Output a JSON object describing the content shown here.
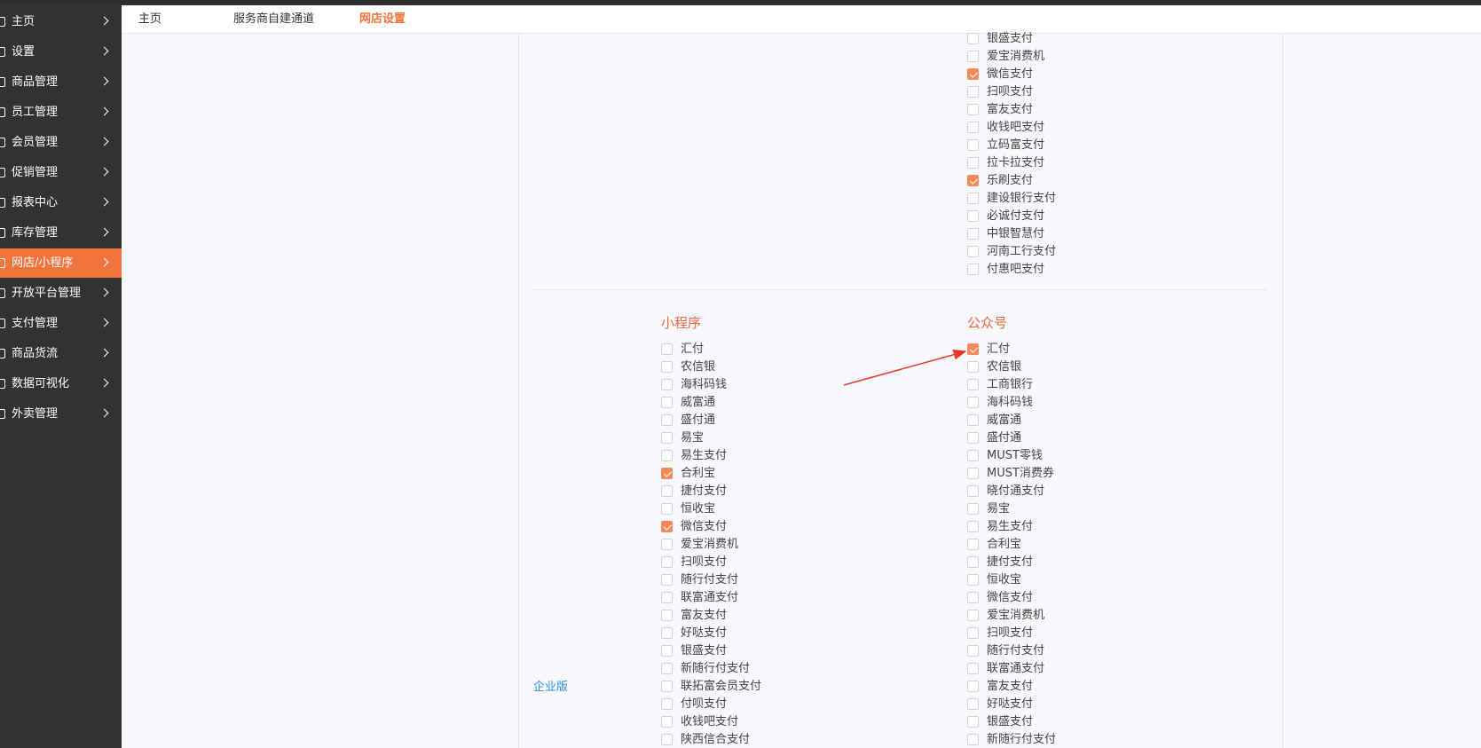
{
  "sidebar": {
    "items": [
      {
        "label": "主页",
        "active": false
      },
      {
        "label": "设置",
        "active": false
      },
      {
        "label": "商品管理",
        "active": false
      },
      {
        "label": "员工管理",
        "active": false
      },
      {
        "label": "会员管理",
        "active": false
      },
      {
        "label": "促销管理",
        "active": false
      },
      {
        "label": "报表中心",
        "active": false
      },
      {
        "label": "库存管理",
        "active": false
      },
      {
        "label": "网店/小程序",
        "active": true
      },
      {
        "label": "开放平台管理",
        "active": false
      },
      {
        "label": "支付管理",
        "active": false
      },
      {
        "label": "商品货流",
        "active": false
      },
      {
        "label": "数据可视化",
        "active": false
      },
      {
        "label": "外卖管理",
        "active": false
      }
    ]
  },
  "tabs": [
    {
      "label": "主页",
      "active": false
    },
    {
      "label": "服务商自建通道",
      "active": false
    },
    {
      "label": "网店设置",
      "active": true
    }
  ],
  "top_list": {
    "options": [
      {
        "label": "银盛支付",
        "checked": false
      },
      {
        "label": "爱宝消费机",
        "checked": false
      },
      {
        "label": "微信支付",
        "checked": true
      },
      {
        "label": "扫呗支付",
        "checked": false
      },
      {
        "label": "富友支付",
        "checked": false
      },
      {
        "label": "收钱吧支付",
        "checked": false
      },
      {
        "label": "立码富支付",
        "checked": false
      },
      {
        "label": "拉卡拉支付",
        "checked": false
      },
      {
        "label": "乐刷支付",
        "checked": true
      },
      {
        "label": "建设银行支付",
        "checked": false
      },
      {
        "label": "必诚付支付",
        "checked": false
      },
      {
        "label": "中银智慧付",
        "checked": false
      },
      {
        "label": "河南工行支付",
        "checked": false
      },
      {
        "label": "付惠吧支付",
        "checked": false
      }
    ]
  },
  "edition_link": "企业版",
  "mini_program": {
    "title": "小程序",
    "options": [
      {
        "label": "汇付",
        "checked": false
      },
      {
        "label": "农信银",
        "checked": false
      },
      {
        "label": "海科码钱",
        "checked": false
      },
      {
        "label": "威富通",
        "checked": false
      },
      {
        "label": "盛付通",
        "checked": false
      },
      {
        "label": "易宝",
        "checked": false
      },
      {
        "label": "易生支付",
        "checked": false
      },
      {
        "label": "合利宝",
        "checked": true
      },
      {
        "label": "捷付支付",
        "checked": false
      },
      {
        "label": "恒收宝",
        "checked": false
      },
      {
        "label": "微信支付",
        "checked": true
      },
      {
        "label": "爱宝消费机",
        "checked": false
      },
      {
        "label": "扫呗支付",
        "checked": false
      },
      {
        "label": "随行付支付",
        "checked": false
      },
      {
        "label": "联富通支付",
        "checked": false
      },
      {
        "label": "富友支付",
        "checked": false
      },
      {
        "label": "好哒支付",
        "checked": false
      },
      {
        "label": "银盛支付",
        "checked": false
      },
      {
        "label": "新随行付支付",
        "checked": false
      },
      {
        "label": "联拓富会员支付",
        "checked": false
      },
      {
        "label": "付呗支付",
        "checked": false
      },
      {
        "label": "收钱吧支付",
        "checked": false
      },
      {
        "label": "陕西信合支付",
        "checked": false
      }
    ]
  },
  "official_account": {
    "title": "公众号",
    "options": [
      {
        "label": "汇付",
        "checked": true
      },
      {
        "label": "农信银",
        "checked": false
      },
      {
        "label": "工商银行",
        "checked": false
      },
      {
        "label": "海科码钱",
        "checked": false
      },
      {
        "label": "威富通",
        "checked": false
      },
      {
        "label": "盛付通",
        "checked": false
      },
      {
        "label": "MUST零钱",
        "checked": false
      },
      {
        "label": "MUST消费券",
        "checked": false
      },
      {
        "label": "晓付通支付",
        "checked": false
      },
      {
        "label": "易宝",
        "checked": false
      },
      {
        "label": "易生支付",
        "checked": false
      },
      {
        "label": "合利宝",
        "checked": false
      },
      {
        "label": "捷付支付",
        "checked": false
      },
      {
        "label": "恒收宝",
        "checked": false
      },
      {
        "label": "微信支付",
        "checked": false
      },
      {
        "label": "爱宝消费机",
        "checked": false
      },
      {
        "label": "扫呗支付",
        "checked": false
      },
      {
        "label": "随行付支付",
        "checked": false
      },
      {
        "label": "联富通支付",
        "checked": false
      },
      {
        "label": "富友支付",
        "checked": false
      },
      {
        "label": "好哒支付",
        "checked": false
      },
      {
        "label": "银盛支付",
        "checked": false
      },
      {
        "label": "新随行付支付",
        "checked": false
      }
    ]
  },
  "colors": {
    "accent": "#f3733c",
    "checkbox_checked": "#f68a5c",
    "section_title": "#f0653a",
    "link": "#2d8cf0",
    "annotation_arrow": "#e8392b"
  }
}
